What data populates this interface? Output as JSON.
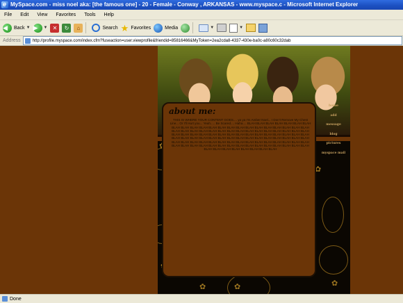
{
  "window": {
    "title": "MySpace.com - miss noel aka: [the famous one] - 20 - Female - Conway , ARKANSAS - www.myspace.c - Microsoft Internet Explorer"
  },
  "menu": {
    "items": [
      "File",
      "Edit",
      "View",
      "Favorites",
      "Tools",
      "Help"
    ]
  },
  "toolbar": {
    "back_label": "Back",
    "search_label": "Search",
    "favorites_label": "Favorites",
    "media_label": "Media"
  },
  "address": {
    "label": "Address",
    "url": "http://profile.myspace.com/index.cfm?fuseaction=user.viewprofile&friendid=85816466&MyToken=2ea2cda8-4337-430e-ba0c-a80c60c32dab"
  },
  "profile": {
    "about_heading": "about me:",
    "about_text": "THIS IS WHERE YOUR CONTENT GOES.... ya ya I'm Amber Noel... I Don't Remove My Chest Line... Or I'll Hurt you... Yeah..... Be Scared.... Haha.... BLAH BLAH BLAH BLAH BLAH BLAH BLAH BLAH BLAH BLAH BLAH BLAH BLAH BLAH BLAH BLAH BLAH BLAH BLAH BLAH BLAH BLAH BLAH BLAH BLAH BLAH BLAH BLAH BLAH BLAH BLAH BLAH BLAH BLAH BLAH BLAH BLAH BLAH BLAH BLAH BLAH BLAH BLAH BLAH BLAH BLAH BLAH BLAH BLAH BLAH BLAH BLAH BLAH BLAH BLAH BLAH BLAH BLAH BLAH BLAH BLAH BLAH BLAH BLAH BLAH BLAH BLAH BLAH BLAH BLAH BLAH BLAH BLAH BLAH BLAH BLAH BLAH BLAH BLAH BLAH BLAH BLAH BLAH BLAH BLAH BLAH BLAH BLAH BLAH BLAH BLAH BLAH BLAH BLAH BLAH BLAH BLAH BLAH BLAH BLAH BLAH BLAH BLAH BLAH BLAH",
    "nav": [
      "home",
      "add",
      "message",
      "blog",
      "pictures",
      "myspace mail"
    ]
  },
  "status": {
    "text": "Done"
  },
  "colors": {
    "page_background": "#6b3507",
    "panel_background": "#0b0702",
    "nav_link": "#c6a060"
  }
}
